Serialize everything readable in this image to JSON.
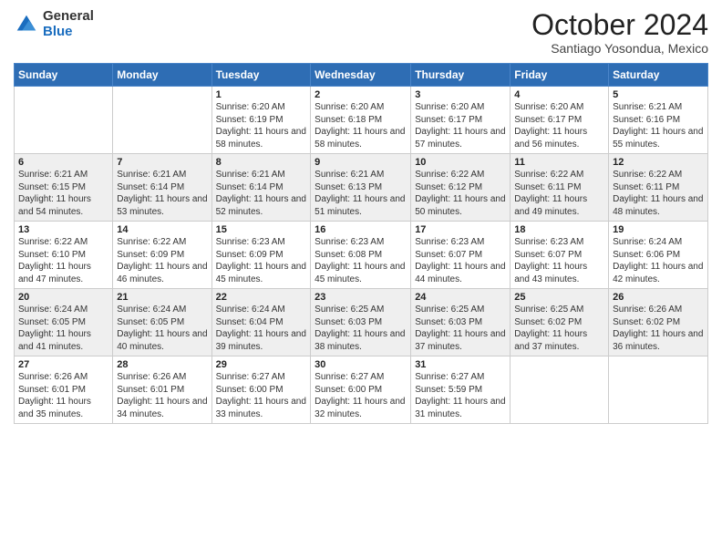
{
  "logo": {
    "general": "General",
    "blue": "Blue"
  },
  "title": "October 2024",
  "location": "Santiago Yosondua, Mexico",
  "days_of_week": [
    "Sunday",
    "Monday",
    "Tuesday",
    "Wednesday",
    "Thursday",
    "Friday",
    "Saturday"
  ],
  "weeks": [
    [
      {
        "num": "",
        "info": ""
      },
      {
        "num": "",
        "info": ""
      },
      {
        "num": "1",
        "info": "Sunrise: 6:20 AM\nSunset: 6:19 PM\nDaylight: 11 hours and 58 minutes."
      },
      {
        "num": "2",
        "info": "Sunrise: 6:20 AM\nSunset: 6:18 PM\nDaylight: 11 hours and 58 minutes."
      },
      {
        "num": "3",
        "info": "Sunrise: 6:20 AM\nSunset: 6:17 PM\nDaylight: 11 hours and 57 minutes."
      },
      {
        "num": "4",
        "info": "Sunrise: 6:20 AM\nSunset: 6:17 PM\nDaylight: 11 hours and 56 minutes."
      },
      {
        "num": "5",
        "info": "Sunrise: 6:21 AM\nSunset: 6:16 PM\nDaylight: 11 hours and 55 minutes."
      }
    ],
    [
      {
        "num": "6",
        "info": "Sunrise: 6:21 AM\nSunset: 6:15 PM\nDaylight: 11 hours and 54 minutes."
      },
      {
        "num": "7",
        "info": "Sunrise: 6:21 AM\nSunset: 6:14 PM\nDaylight: 11 hours and 53 minutes."
      },
      {
        "num": "8",
        "info": "Sunrise: 6:21 AM\nSunset: 6:14 PM\nDaylight: 11 hours and 52 minutes."
      },
      {
        "num": "9",
        "info": "Sunrise: 6:21 AM\nSunset: 6:13 PM\nDaylight: 11 hours and 51 minutes."
      },
      {
        "num": "10",
        "info": "Sunrise: 6:22 AM\nSunset: 6:12 PM\nDaylight: 11 hours and 50 minutes."
      },
      {
        "num": "11",
        "info": "Sunrise: 6:22 AM\nSunset: 6:11 PM\nDaylight: 11 hours and 49 minutes."
      },
      {
        "num": "12",
        "info": "Sunrise: 6:22 AM\nSunset: 6:11 PM\nDaylight: 11 hours and 48 minutes."
      }
    ],
    [
      {
        "num": "13",
        "info": "Sunrise: 6:22 AM\nSunset: 6:10 PM\nDaylight: 11 hours and 47 minutes."
      },
      {
        "num": "14",
        "info": "Sunrise: 6:22 AM\nSunset: 6:09 PM\nDaylight: 11 hours and 46 minutes."
      },
      {
        "num": "15",
        "info": "Sunrise: 6:23 AM\nSunset: 6:09 PM\nDaylight: 11 hours and 45 minutes."
      },
      {
        "num": "16",
        "info": "Sunrise: 6:23 AM\nSunset: 6:08 PM\nDaylight: 11 hours and 45 minutes."
      },
      {
        "num": "17",
        "info": "Sunrise: 6:23 AM\nSunset: 6:07 PM\nDaylight: 11 hours and 44 minutes."
      },
      {
        "num": "18",
        "info": "Sunrise: 6:23 AM\nSunset: 6:07 PM\nDaylight: 11 hours and 43 minutes."
      },
      {
        "num": "19",
        "info": "Sunrise: 6:24 AM\nSunset: 6:06 PM\nDaylight: 11 hours and 42 minutes."
      }
    ],
    [
      {
        "num": "20",
        "info": "Sunrise: 6:24 AM\nSunset: 6:05 PM\nDaylight: 11 hours and 41 minutes."
      },
      {
        "num": "21",
        "info": "Sunrise: 6:24 AM\nSunset: 6:05 PM\nDaylight: 11 hours and 40 minutes."
      },
      {
        "num": "22",
        "info": "Sunrise: 6:24 AM\nSunset: 6:04 PM\nDaylight: 11 hours and 39 minutes."
      },
      {
        "num": "23",
        "info": "Sunrise: 6:25 AM\nSunset: 6:03 PM\nDaylight: 11 hours and 38 minutes."
      },
      {
        "num": "24",
        "info": "Sunrise: 6:25 AM\nSunset: 6:03 PM\nDaylight: 11 hours and 37 minutes."
      },
      {
        "num": "25",
        "info": "Sunrise: 6:25 AM\nSunset: 6:02 PM\nDaylight: 11 hours and 37 minutes."
      },
      {
        "num": "26",
        "info": "Sunrise: 6:26 AM\nSunset: 6:02 PM\nDaylight: 11 hours and 36 minutes."
      }
    ],
    [
      {
        "num": "27",
        "info": "Sunrise: 6:26 AM\nSunset: 6:01 PM\nDaylight: 11 hours and 35 minutes."
      },
      {
        "num": "28",
        "info": "Sunrise: 6:26 AM\nSunset: 6:01 PM\nDaylight: 11 hours and 34 minutes."
      },
      {
        "num": "29",
        "info": "Sunrise: 6:27 AM\nSunset: 6:00 PM\nDaylight: 11 hours and 33 minutes."
      },
      {
        "num": "30",
        "info": "Sunrise: 6:27 AM\nSunset: 6:00 PM\nDaylight: 11 hours and 32 minutes."
      },
      {
        "num": "31",
        "info": "Sunrise: 6:27 AM\nSunset: 5:59 PM\nDaylight: 11 hours and 31 minutes."
      },
      {
        "num": "",
        "info": ""
      },
      {
        "num": "",
        "info": ""
      }
    ]
  ]
}
